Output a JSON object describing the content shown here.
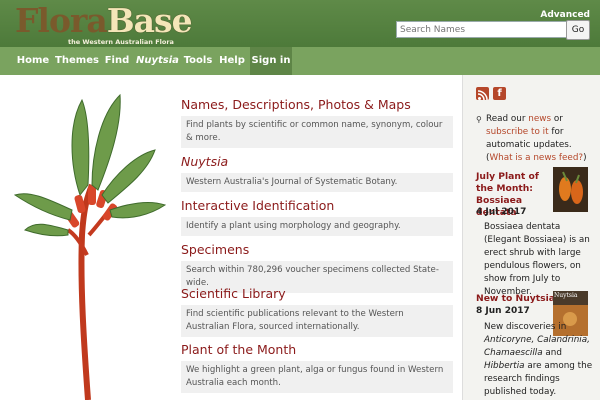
{
  "header": {
    "logo_part1": "Flora",
    "logo_part2": "Base",
    "logo_subtitle": "the Western Australian Flora",
    "advanced_link": "Advanced",
    "search_placeholder": "Search Names",
    "go_button": "Go"
  },
  "nav": {
    "items": [
      {
        "label": "Home"
      },
      {
        "label": "Themes"
      },
      {
        "label": "Find"
      },
      {
        "label": "Nuytsia"
      },
      {
        "label": "Tools"
      },
      {
        "label": "Help"
      },
      {
        "label": "Sign in"
      }
    ]
  },
  "main": {
    "entries": [
      {
        "title": "Names, Descriptions, Photos & Maps",
        "desc": "Find plants by scientific or common name, synonym, colour & more."
      },
      {
        "title": "Nuytsia",
        "desc": "Western Australia's Journal of Systematic Botany."
      },
      {
        "title": "Interactive Identification",
        "desc": "Identify a plant using morphology and geography."
      },
      {
        "title": "Specimens",
        "desc": "Search within 780,296 voucher specimens collected State-wide."
      },
      {
        "title": "Scientific Library",
        "desc": "Find scientific publications relevant to the Western Australian Flora, sourced internationally."
      },
      {
        "title": "Plant of the Month",
        "desc": "We highlight a green plant, alga or fungus found in Western Australia each month."
      }
    ]
  },
  "sidebar": {
    "news_read": "Read our ",
    "news_link": "news",
    "news_or": " or",
    "subscribe_link": "subscribe to it",
    "news_for": " for",
    "news_auto": "automatic updates. (",
    "news_feed_link": "What is a news feed?",
    "news_close": ")",
    "potm": {
      "title": "July Plant of the Month: Bossiaea dentata",
      "date": "4 Jul 2017",
      "text": "Bossiaea dentata (Elegant Bossiaea) is an erect shrub with large pendulous flowers, on show from July to November."
    },
    "nuytsia_news": {
      "title": "New to Nuytsia",
      "date": "8 Jun 2017",
      "text_1": "New discoveries in",
      "genus_1": "Anticoryne,",
      "genus_2": "Calandrinia,",
      "genus_3": "Chamaescilla",
      "and": " and ",
      "genus_4": "Hibbertia",
      "text_2": "are among the research findings published today.",
      "thumb_label": "Nuytsia"
    }
  },
  "colors": {
    "header_green": "#5f8a48",
    "nav_green": "#7aa35f",
    "title_red": "#8b1a1a",
    "link_red": "#b5472a"
  }
}
